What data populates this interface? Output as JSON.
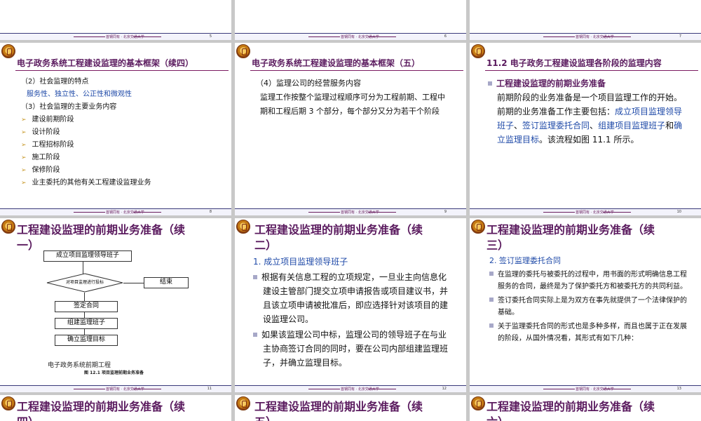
{
  "footer_text": "首钢同有 · 北京交通大学",
  "row0": {
    "pages": [
      "5",
      "6",
      "7"
    ]
  },
  "s8": {
    "title": "电子政务系统工程建设监理的基本框架（续四）",
    "h1": "（2）社会监理的特点",
    "h1_sub": "服务性、独立性、公正性和微观性",
    "h2": "（3）社会监理的主要业务内容",
    "items": [
      "建设前期阶段",
      "设计阶段",
      "工程招标阶段",
      "施工阶段",
      "保修阶段",
      "业主委托的其他有关工程建设监理业务"
    ],
    "page": "8"
  },
  "s9": {
    "title": "电子政务系统工程建设监理的基本框架（五）",
    "h": "（4）监理公司的经营服务内容",
    "body": "监理工作按整个监理过程顺序可分为工程前期、工程中期和工程后期 3 个部分，每个部分又分为若干个阶段",
    "page": "9"
  },
  "s10": {
    "title": "11.2  电子政务工程建设监理各阶段的监理内容",
    "bullet": "工程建设监理的前期业务准备",
    "body_pre": "前期阶段的业务准备是一个项目监理工作的开始。前期的业务准备工作主要包括：",
    "hl1": "成立项目监理领导班子",
    "sep1": "、",
    "hl2": "签订监理委托合同",
    "sep2": "、",
    "hl3": "组建项目监理班子",
    "and": "和",
    "hl4": "确立监理目标",
    "body_post": "。该流程如图 11.1 所示。",
    "page": "10"
  },
  "s11": {
    "title": "工程建设监理的前期业务准备（续一）",
    "fc": {
      "n1": "成立项目监理领导班子",
      "n2": "对项目监理进行投标",
      "n3": "结束",
      "n4": "签定合同",
      "n5": "组建监理班子",
      "n6": "确立监理目标"
    },
    "caption1": "电子政务系统前期工程",
    "caption2": "图 12.1  项目监理前期业务准备",
    "page": "11"
  },
  "s12": {
    "title": "工程建设监理的前期业务准备（续二）",
    "h": "1. 成立项目监理领导班子",
    "p1": "根据有关信息工程的立项规定，一旦业主向信息化建设主管部门提交立项申请报告或项目建议书，并且该立项申请被批准后，即应选择针对该项目的建设监理公司。",
    "p2": "如果该监理公司中标，监理公司的领导班子在与业主协商签订合同的同时，要在公司内部组建监理班子，并确立监理目标。",
    "page": "12"
  },
  "s13": {
    "title": "工程建设监理的前期业务准备（续三）",
    "h": "2. 签订监理委托合同",
    "p1": "在监理的委托与被委托的过程中，用书面的形式明确信息工程服务的合同，最终是为了保护委托方和被委托方的共同利益。",
    "p2": "签订委托合同实际上是为双方在事先就提供了一个法律保护的基础。",
    "p3": "关于监理委托合同的形式也是多种多样，而且也属于正在发展的阶段，从国外情况看，其形式有如下几种：",
    "page": "13"
  },
  "row4": {
    "t1": "工程建设监理的前期业务准备（续四）",
    "t2": "工程建设监理的前期业务准备（续五）",
    "t3": "工程建设监理的前期业务准备（续六）"
  },
  "colors": {
    "title": "#5a1a5e",
    "link": "#1f4aa8",
    "footer": "#6b2060"
  }
}
